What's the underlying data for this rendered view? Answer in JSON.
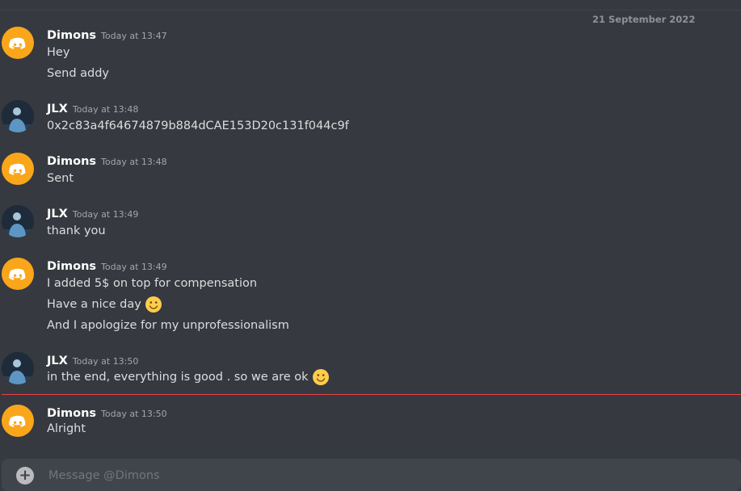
{
  "date_divider": "21 September 2022",
  "colors": {
    "background": "#36393f",
    "discord_avatar": "#faa61a",
    "new_messages_line": "#ed4245",
    "composer": "#40444b"
  },
  "messages": [
    {
      "author": "Dimons",
      "avatar": "discord-logo-icon",
      "time": "Today at 13:47",
      "lines": [
        "Hey",
        "Send addy"
      ]
    },
    {
      "author": "JLX",
      "avatar": "user-photo",
      "time": "Today at 13:48",
      "lines": [
        "0x2c83a4f64674879b884dCAE153D20c131f044c9f"
      ]
    },
    {
      "author": "Dimons",
      "avatar": "discord-logo-icon",
      "time": "Today at 13:48",
      "lines": [
        "Sent"
      ]
    },
    {
      "author": "JLX",
      "avatar": "user-photo",
      "time": "Today at 13:49",
      "lines": [
        "thank you"
      ]
    },
    {
      "author": "Dimons",
      "avatar": "discord-logo-icon",
      "time": "Today at 13:49",
      "lines": [
        "I added 5$ on top for compensation",
        "Have a nice day",
        "And I apologize for my unprofessionalism"
      ],
      "emoji_on_line": [
        1
      ]
    },
    {
      "author": "JLX",
      "avatar": "user-photo",
      "time": "Today at 13:50",
      "lines": [
        "in the end, everything is good . so we are ok"
      ],
      "emoji_on_line": [
        0
      ]
    },
    {
      "author": "Dimons",
      "avatar": "discord-logo-icon",
      "time": "Today at 13:50",
      "lines": [
        "Alright"
      ]
    }
  ],
  "emoji": "slightly-smiling-face-icon",
  "composer": {
    "placeholder": "Message @Dimons"
  }
}
